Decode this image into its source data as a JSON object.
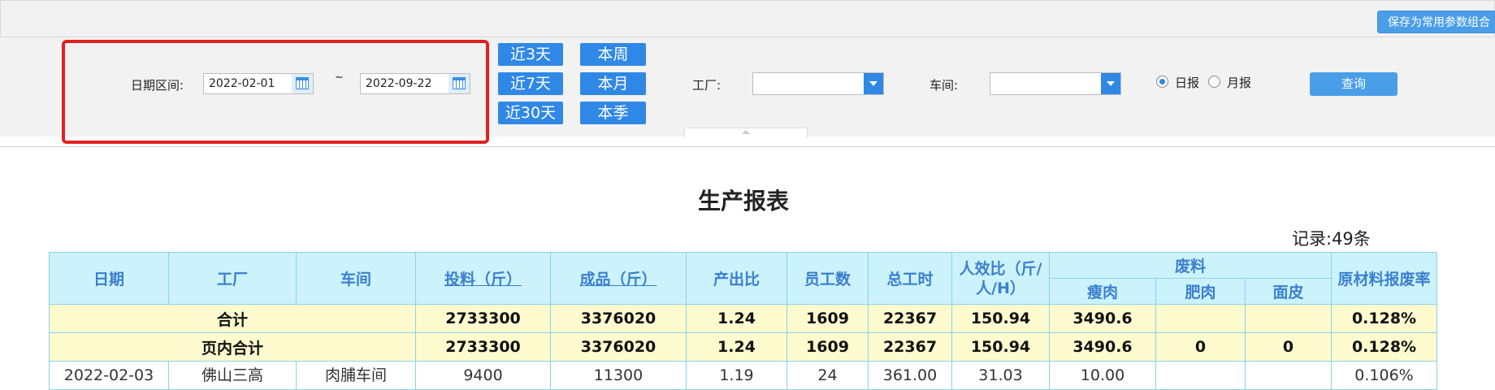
{
  "toolbar": {
    "save_label": "保存为常用参数组合"
  },
  "filter": {
    "date_range_label": "日期区间:",
    "date_start": "2022-02-01",
    "tilde": "~",
    "date_end": "2022-09-22",
    "quick_buttons": [
      "近3天",
      "近7天",
      "近30天",
      "本周",
      "本月",
      "本季"
    ],
    "factory_label": "工厂:",
    "factory_value": "",
    "workshop_label": "车间:",
    "workshop_value": "",
    "report_daily": "日报",
    "report_monthly": "月报",
    "selected_report": "日报",
    "query_label": "查询"
  },
  "report": {
    "title": "生产报表",
    "records": "记录:49条",
    "headers": {
      "date": "日期",
      "factory": "工厂",
      "workshop": "车间",
      "input": "投料（斤）",
      "output": "成品（斤）",
      "ratio": "产出比",
      "staff": "员工数",
      "hours": "总工时",
      "efficiency": "人效比（斤/人/H）",
      "waste": "废料",
      "lean": "瘦肉",
      "fat": "肥肉",
      "skin": "面皮",
      "scrap_rate": "原材料报废率"
    },
    "total_row": {
      "label": "合计",
      "input": "2733300",
      "output": "3376020",
      "ratio": "1.24",
      "staff": "1609",
      "hours": "22367",
      "efficiency": "150.94",
      "lean": "3490.6",
      "fat": "",
      "skin": "",
      "scrap_rate": "0.128%"
    },
    "page_total_row": {
      "label": "页内合计",
      "input": "2733300",
      "output": "3376020",
      "ratio": "1.24",
      "staff": "1609",
      "hours": "22367",
      "efficiency": "150.94",
      "lean": "3490.6",
      "fat": "0",
      "skin": "0",
      "scrap_rate": "0.128%"
    },
    "first_row": {
      "date": "2022-02-03",
      "factory": "佛山三高",
      "workshop": "肉脯车间",
      "input": "9400",
      "output": "11300",
      "ratio": "1.19",
      "staff": "24",
      "hours": "361.00",
      "efficiency": "31.03",
      "lean": "10.00",
      "fat": "",
      "skin": "",
      "scrap_rate": "0.106%"
    }
  }
}
